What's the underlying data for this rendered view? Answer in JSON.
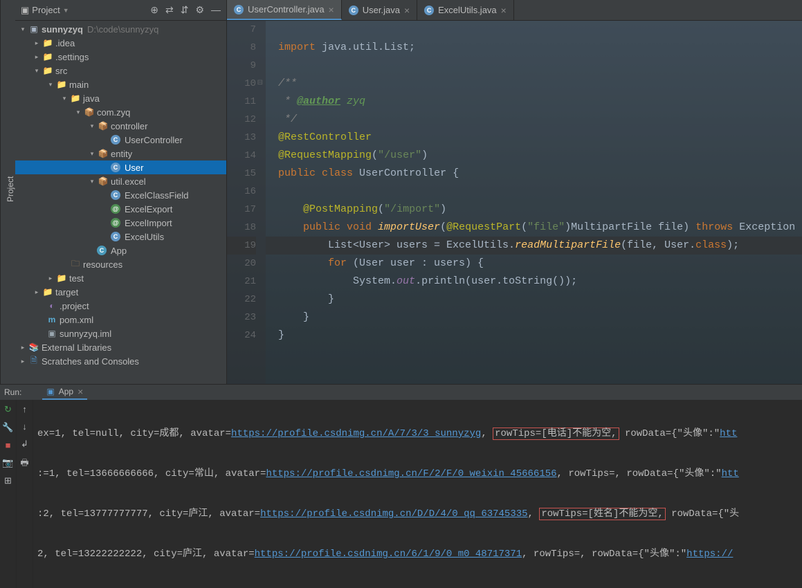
{
  "vertical_tab": "Project",
  "project_header": {
    "title": "Project"
  },
  "tree": {
    "root": "sunnyzyq",
    "root_hint": "D:\\code\\sunnyzyq",
    "idea": ".idea",
    "settings": ".settings",
    "src": "src",
    "main": "main",
    "java": "java",
    "package": "com.zyq",
    "controller": "controller",
    "usercontroller": "UserController",
    "entity": "entity",
    "user": "User",
    "utilexcel": "util.excel",
    "excelclassfield": "ExcelClassField",
    "excelexport": "ExcelExport",
    "excelimport": "ExcelImport",
    "excelutils": "ExcelUtils",
    "app": "App",
    "resources": "resources",
    "test": "test",
    "target": "target",
    "project_file": ".project",
    "pom": "pom.xml",
    "iml": "sunnyzyq.iml",
    "ext_lib": "External Libraries",
    "scratches": "Scratches and Consoles"
  },
  "tabs": [
    {
      "label": "UserController.java",
      "active": true
    },
    {
      "label": "User.java",
      "active": false
    },
    {
      "label": "ExcelUtils.java",
      "active": false
    }
  ],
  "code": {
    "lines": [
      "7",
      "8",
      "9",
      "10",
      "11",
      "12",
      "13",
      "14",
      "15",
      "16",
      "17",
      "18",
      "19",
      "20",
      "21",
      "22",
      "23",
      "24"
    ],
    "l8_import": "import",
    "l8_pkg": " java.util.List;",
    "l10_c": "/**",
    "l11_a": " * ",
    "l11_tag": "@author",
    "l11_name": " zyq",
    "l12_c": " */",
    "l13_a": "@RestController",
    "l14_a": "@RequestMapping",
    "l14_s": "\"/user\"",
    "l15_pub": "public ",
    "l15_cls": "class ",
    "l15_name": "UserController {",
    "l17_a": "@PostMapping",
    "l17_s": "\"/import\"",
    "l18_pub": "public ",
    "l18_void": "void ",
    "l18_m": "importUser",
    "l18_ann": "@RequestPart",
    "l18_file": "\"file\"",
    "l18_rest": "MultipartFile file) ",
    "l18_throws": "throws ",
    "l18_exc": "Exception ",
    "l19_list": "List<User> users = ExcelUtils.",
    "l19_method": "readMultipartFile",
    "l19_args": "(file, User.",
    "l19_class": "class",
    "l19_end": ");",
    "l20_for": "for ",
    "l20_rest": "(User user : users) {",
    "l21_sys": "System.",
    "l21_out": "out",
    "l21_rest": ".println(user.toString());",
    "l22": "}",
    "l23": "}",
    "l24": "}"
  },
  "run": {
    "label": "Run:",
    "tab": "App",
    "lines": [
      {
        "pre": "ex=1, tel=null, city=成都, avatar=",
        "url": "https://profile.csdnimg.cn/A/7/3/3_sunnyzyg",
        "mid": ", ",
        "hl": "rowTips=[电话]不能为空,",
        "post": " rowData={\"头像\":\"",
        "url2": "htt"
      },
      {
        "pre": ":=1, tel=13666666666, city=常山, avatar=",
        "url": "https://profile.csdnimg.cn/F/2/F/0_weixin_45666156",
        "mid": ", rowTips=, rowData={\"头像\":\"",
        "url2": "htt"
      },
      {
        "pre": ":2, tel=13777777777, city=庐江, avatar=",
        "url": "https://profile.csdnimg.cn/D/D/4/0_qq_63745335",
        "mid": ", ",
        "hl": "rowTips=[姓名]不能为空,",
        "post": " rowData={\"头"
      },
      {
        "pre": "2, tel=13222222222, city=庐江, avatar=",
        "url": "https://profile.csdnimg.cn/6/1/9/0_m0_48717371",
        "mid": ", rowTips=, rowData={\"头像\":\"",
        "url2": "https://"
      }
    ]
  }
}
